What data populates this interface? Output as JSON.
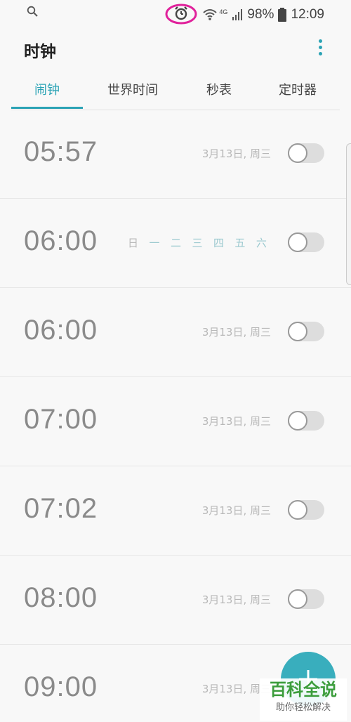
{
  "status_bar": {
    "battery": "98%",
    "time": "12:09",
    "network": "4G",
    "icons": [
      "search-icon",
      "alarm-icon",
      "wifi-icon",
      "signal-icon",
      "battery-icon"
    ]
  },
  "header": {
    "title": "时钟",
    "more_icon": "more-vertical-icon"
  },
  "tabs": [
    "闹钟",
    "世界时间",
    "秒表",
    "定时器"
  ],
  "accent_color": "#2ba3b5",
  "alarms": [
    {
      "time": "05:57",
      "date": "3月13日, 周三",
      "enabled": false
    },
    {
      "time": "06:00",
      "days": [
        "日",
        "一",
        "二",
        "三",
        "四",
        "五",
        "六"
      ],
      "enabled": false
    },
    {
      "time": "06:00",
      "date": "3月13日, 周三",
      "enabled": false
    },
    {
      "time": "07:00",
      "date": "3月13日, 周三",
      "enabled": false
    },
    {
      "time": "07:02",
      "date": "3月13日, 周三",
      "enabled": false
    },
    {
      "time": "08:00",
      "date": "3月13日, 周三",
      "enabled": false
    },
    {
      "time": "09:00",
      "date": "3月13日, 周三",
      "enabled": false
    }
  ],
  "fab_icon": "add-icon",
  "watermark": {
    "main": "百科全说",
    "sub": "助你轻松解决"
  }
}
